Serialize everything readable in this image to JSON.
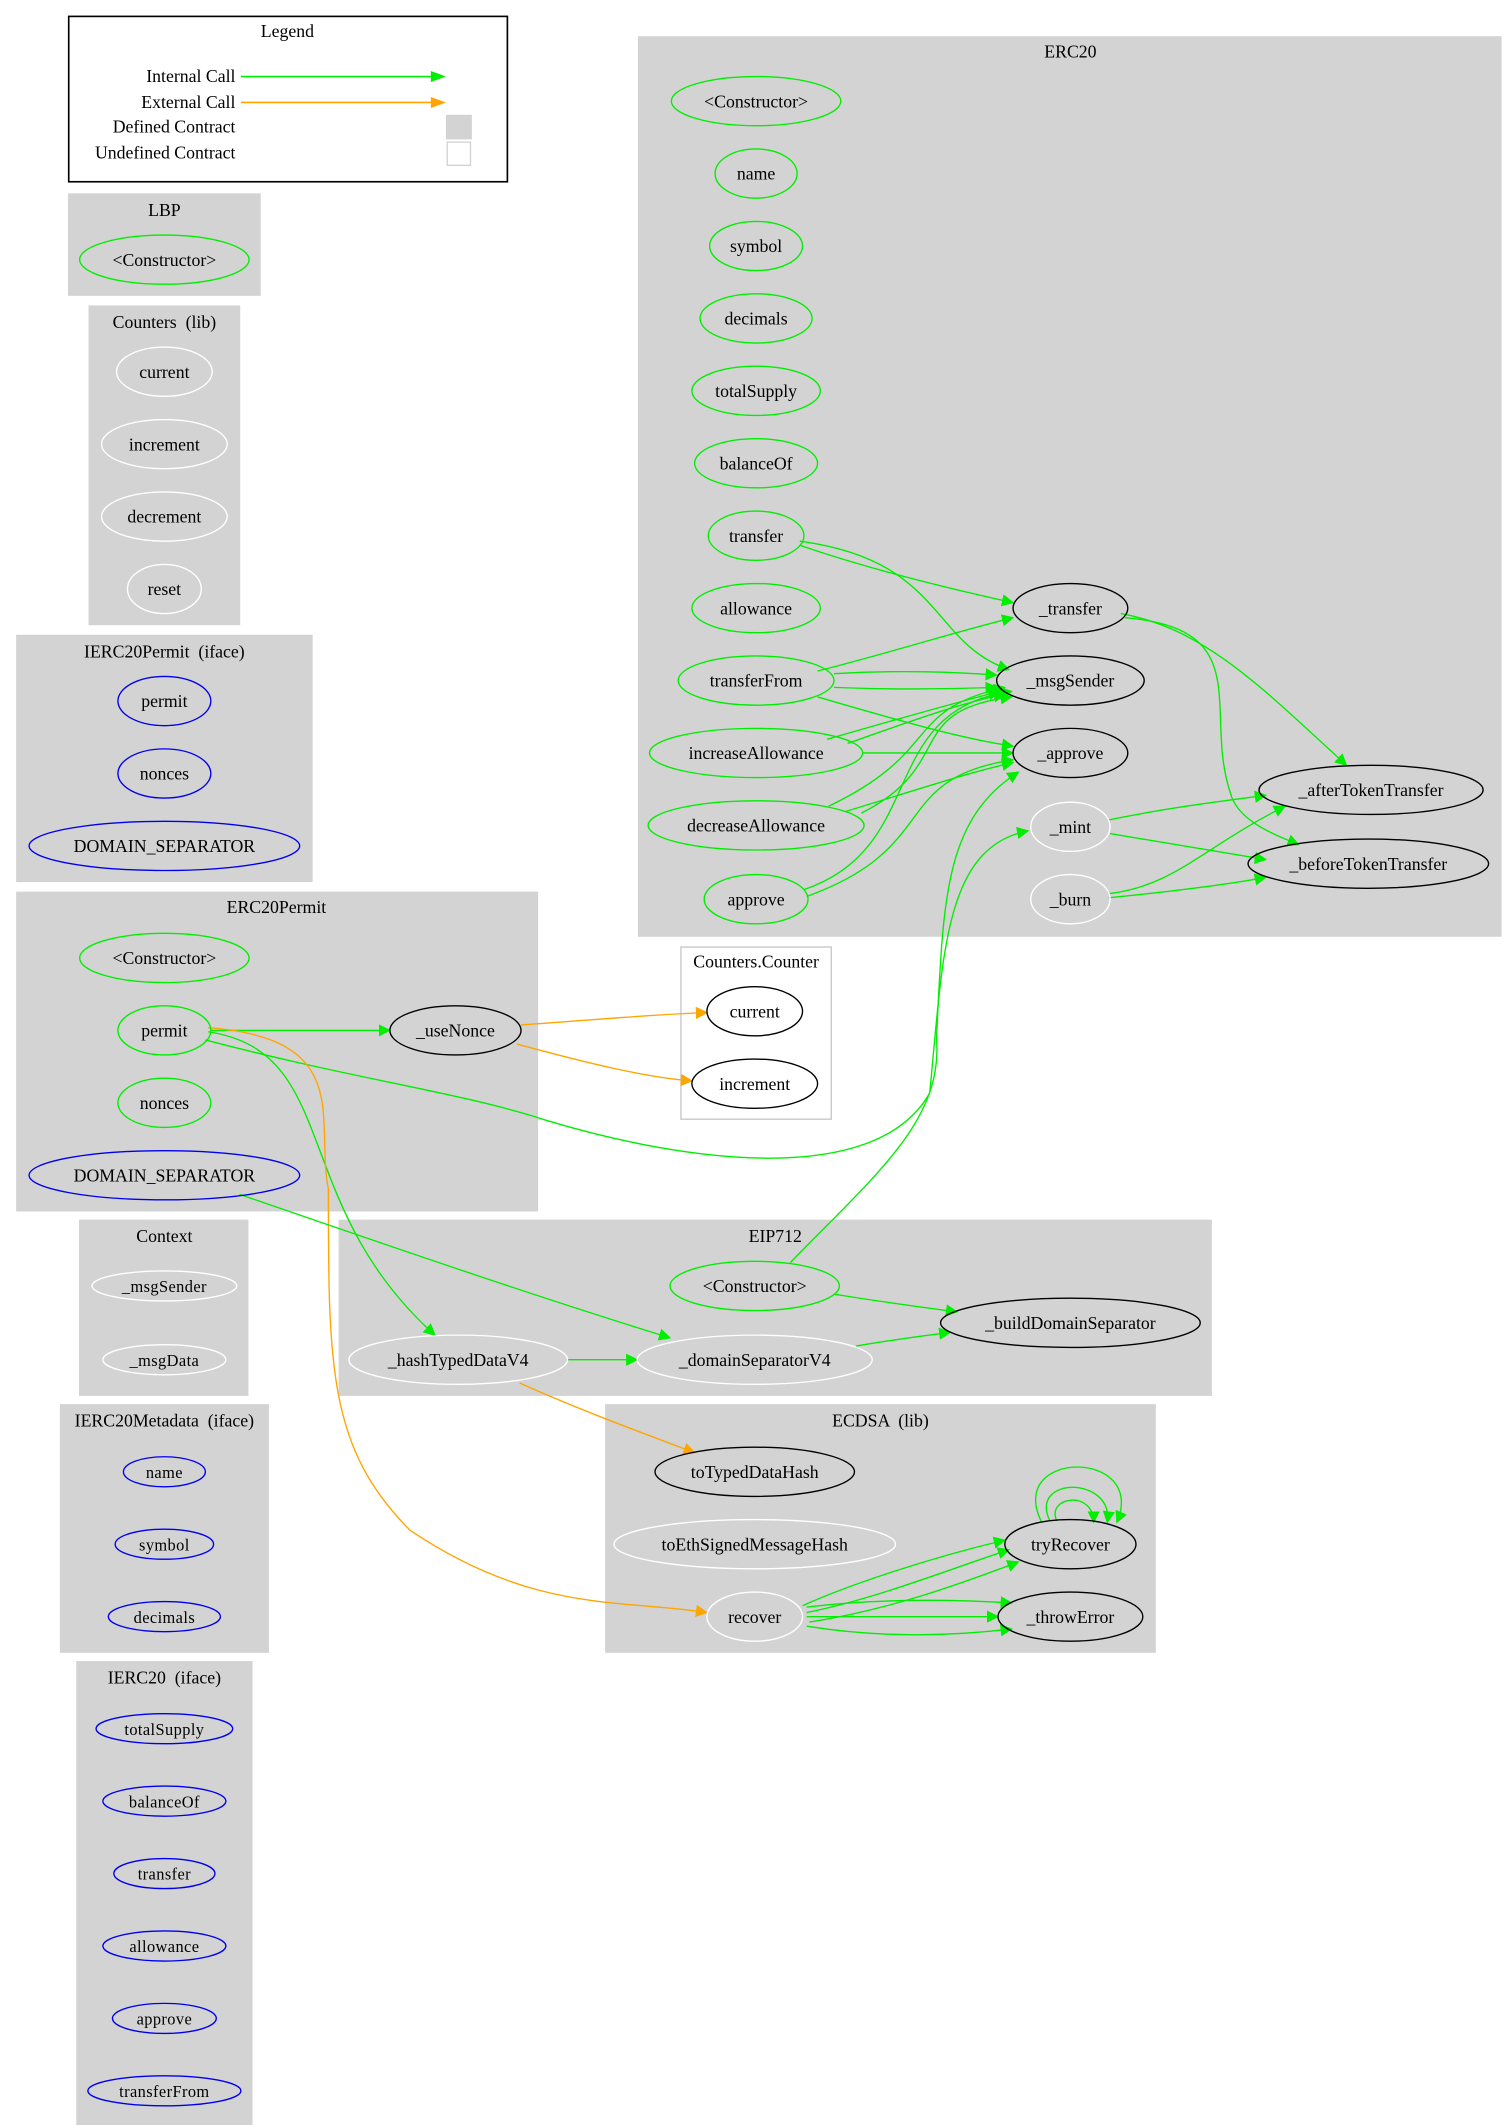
{
  "colors": {
    "internal_call": "#00ee00",
    "external_call": "#ffa500",
    "defined_contract": "#d3d3d3",
    "public_function": "#00ee00",
    "interface_function": "#0000ee",
    "internal_function": "#ffffff",
    "external_target": "#000000"
  },
  "legend": {
    "title": "Legend",
    "items": [
      {
        "label": "Internal Call",
        "kind": "internal_call"
      },
      {
        "label": "External Call",
        "kind": "external_call"
      },
      {
        "label": "Defined Contract",
        "kind": "defined_contract"
      },
      {
        "label": "Undefined Contract",
        "kind": "undefined_contract"
      }
    ]
  },
  "clusters": {
    "LBP": {
      "title": "LBP",
      "nodes": {
        "constructor": "<Constructor>"
      }
    },
    "Counters": {
      "title": "Counters  (lib)",
      "nodes": {
        "current": "current",
        "increment": "increment",
        "decrement": "decrement",
        "reset": "reset"
      }
    },
    "IERC20Permit": {
      "title": "IERC20Permit  (iface)",
      "nodes": {
        "permit": "permit",
        "nonces": "nonces",
        "DOMAIN_SEPARATOR": "DOMAIN_SEPARATOR"
      }
    },
    "ERC20Permit": {
      "title": "ERC20Permit",
      "nodes": {
        "constructor": "<Constructor>",
        "permit": "permit",
        "_useNonce": "_useNonce",
        "nonces": "nonces",
        "DOMAIN_SEPARATOR": "DOMAIN_SEPARATOR"
      }
    },
    "Context": {
      "title": "Context",
      "nodes": {
        "_msgSender": "_msgSender",
        "_msgData": "_msgData"
      }
    },
    "IERC20Metadata": {
      "title": "IERC20Metadata  (iface)",
      "nodes": {
        "name": "name",
        "symbol": "symbol",
        "decimals": "decimals"
      }
    },
    "IERC20": {
      "title": "IERC20  (iface)",
      "nodes": {
        "totalSupply": "totalSupply",
        "balanceOf": "balanceOf",
        "transfer": "transfer",
        "allowance": "allowance",
        "approve": "approve",
        "transferFrom": "transferFrom"
      }
    },
    "ERC20": {
      "title": "ERC20",
      "nodes": {
        "constructor": "<Constructor>",
        "name": "name",
        "symbol": "symbol",
        "decimals": "decimals",
        "totalSupply": "totalSupply",
        "balanceOf": "balanceOf",
        "transfer": "transfer",
        "allowance": "allowance",
        "transferFrom": "transferFrom",
        "increaseAllowance": "increaseAllowance",
        "decreaseAllowance": "decreaseAllowance",
        "approve": "approve",
        "_transfer": "_transfer",
        "_msgSender": "_msgSender",
        "_approve": "_approve",
        "_mint": "_mint",
        "_burn": "_burn",
        "_afterTokenTransfer": "_afterTokenTransfer",
        "_beforeTokenTransfer": "_beforeTokenTransfer"
      }
    },
    "CountersCounter": {
      "title": "Counters.Counter",
      "nodes": {
        "current": "current",
        "increment": "increment"
      }
    },
    "EIP712": {
      "title": "EIP712",
      "nodes": {
        "constructor": "<Constructor>",
        "_buildDomainSeparator": "_buildDomainSeparator",
        "_hashTypedDataV4": "_hashTypedDataV4",
        "_domainSeparatorV4": "_domainSeparatorV4"
      }
    },
    "ECDSA": {
      "title": "ECDSA  (lib)",
      "nodes": {
        "toTypedDataHash": "toTypedDataHash",
        "toEthSignedMessageHash": "toEthSignedMessageHash",
        "tryRecover": "tryRecover",
        "recover": "recover",
        "_throwError": "_throwError"
      }
    }
  },
  "edges": [
    {
      "from": "ERC20.transfer",
      "to": "ERC20._transfer",
      "kind": "internal_call"
    },
    {
      "from": "ERC20.transfer",
      "to": "ERC20._msgSender",
      "kind": "internal_call"
    },
    {
      "from": "ERC20.transferFrom",
      "to": "ERC20._transfer",
      "kind": "internal_call"
    },
    {
      "from": "ERC20.transferFrom",
      "to": "ERC20._msgSender",
      "kind": "internal_call"
    },
    {
      "from": "ERC20.transferFrom",
      "to": "ERC20._msgSender",
      "kind": "internal_call"
    },
    {
      "from": "ERC20.transferFrom",
      "to": "ERC20._approve",
      "kind": "internal_call"
    },
    {
      "from": "ERC20.increaseAllowance",
      "to": "ERC20._msgSender",
      "kind": "internal_call"
    },
    {
      "from": "ERC20.increaseAllowance",
      "to": "ERC20._msgSender",
      "kind": "internal_call"
    },
    {
      "from": "ERC20.increaseAllowance",
      "to": "ERC20._approve",
      "kind": "internal_call"
    },
    {
      "from": "ERC20.decreaseAllowance",
      "to": "ERC20._msgSender",
      "kind": "internal_call"
    },
    {
      "from": "ERC20.decreaseAllowance",
      "to": "ERC20._msgSender",
      "kind": "internal_call"
    },
    {
      "from": "ERC20.decreaseAllowance",
      "to": "ERC20._approve",
      "kind": "internal_call"
    },
    {
      "from": "ERC20.approve",
      "to": "ERC20._msgSender",
      "kind": "internal_call"
    },
    {
      "from": "ERC20.approve",
      "to": "ERC20._approve",
      "kind": "internal_call"
    },
    {
      "from": "ERC20._transfer",
      "to": "ERC20._afterTokenTransfer",
      "kind": "internal_call"
    },
    {
      "from": "ERC20._transfer",
      "to": "ERC20._beforeTokenTransfer",
      "kind": "internal_call"
    },
    {
      "from": "ERC20._mint",
      "to": "ERC20._afterTokenTransfer",
      "kind": "internal_call"
    },
    {
      "from": "ERC20._mint",
      "to": "ERC20._beforeTokenTransfer",
      "kind": "internal_call"
    },
    {
      "from": "ERC20._burn",
      "to": "ERC20._afterTokenTransfer",
      "kind": "internal_call"
    },
    {
      "from": "ERC20._burn",
      "to": "ERC20._beforeTokenTransfer",
      "kind": "internal_call"
    },
    {
      "from": "ERC20Permit.permit",
      "to": "ERC20Permit._useNonce",
      "kind": "internal_call"
    },
    {
      "from": "ERC20Permit.permit",
      "to": "ERC20._approve",
      "kind": "internal_call"
    },
    {
      "from": "ERC20Permit.permit",
      "to": "EIP712._hashTypedDataV4",
      "kind": "internal_call"
    },
    {
      "from": "ERC20Permit.permit",
      "to": "ECDSA.recover",
      "kind": "external_call"
    },
    {
      "from": "ERC20Permit._useNonce",
      "to": "CountersCounter.current",
      "kind": "external_call"
    },
    {
      "from": "ERC20Permit._useNonce",
      "to": "CountersCounter.increment",
      "kind": "external_call"
    },
    {
      "from": "ERC20Permit.DOMAIN_SEPARATOR",
      "to": "EIP712._domainSeparatorV4",
      "kind": "internal_call"
    },
    {
      "from": "EIP712.constructor",
      "to": "EIP712._buildDomainSeparator",
      "kind": "internal_call"
    },
    {
      "from": "EIP712.constructor",
      "to": "ERC20._msgSender",
      "kind": "internal_call"
    },
    {
      "from": "EIP712._hashTypedDataV4",
      "to": "EIP712._domainSeparatorV4",
      "kind": "internal_call"
    },
    {
      "from": "EIP712._domainSeparatorV4",
      "to": "EIP712._buildDomainSeparator",
      "kind": "internal_call"
    },
    {
      "from": "EIP712._hashTypedDataV4",
      "to": "ECDSA.toTypedDataHash",
      "kind": "external_call"
    },
    {
      "from": "ECDSA.recover",
      "to": "ECDSA.tryRecover",
      "kind": "internal_call"
    },
    {
      "from": "ECDSA.recover",
      "to": "ECDSA.tryRecover",
      "kind": "internal_call"
    },
    {
      "from": "ECDSA.recover",
      "to": "ECDSA.tryRecover",
      "kind": "internal_call"
    },
    {
      "from": "ECDSA.recover",
      "to": "ECDSA._throwError",
      "kind": "internal_call"
    },
    {
      "from": "ECDSA.recover",
      "to": "ECDSA._throwError",
      "kind": "internal_call"
    },
    {
      "from": "ECDSA.recover",
      "to": "ECDSA._throwError",
      "kind": "internal_call"
    },
    {
      "from": "ECDSA.tryRecover",
      "to": "ECDSA.tryRecover",
      "kind": "internal_call"
    },
    {
      "from": "ECDSA.tryRecover",
      "to": "ECDSA.tryRecover",
      "kind": "internal_call"
    },
    {
      "from": "ECDSA.tryRecover",
      "to": "ECDSA.tryRecover",
      "kind": "internal_call"
    }
  ]
}
